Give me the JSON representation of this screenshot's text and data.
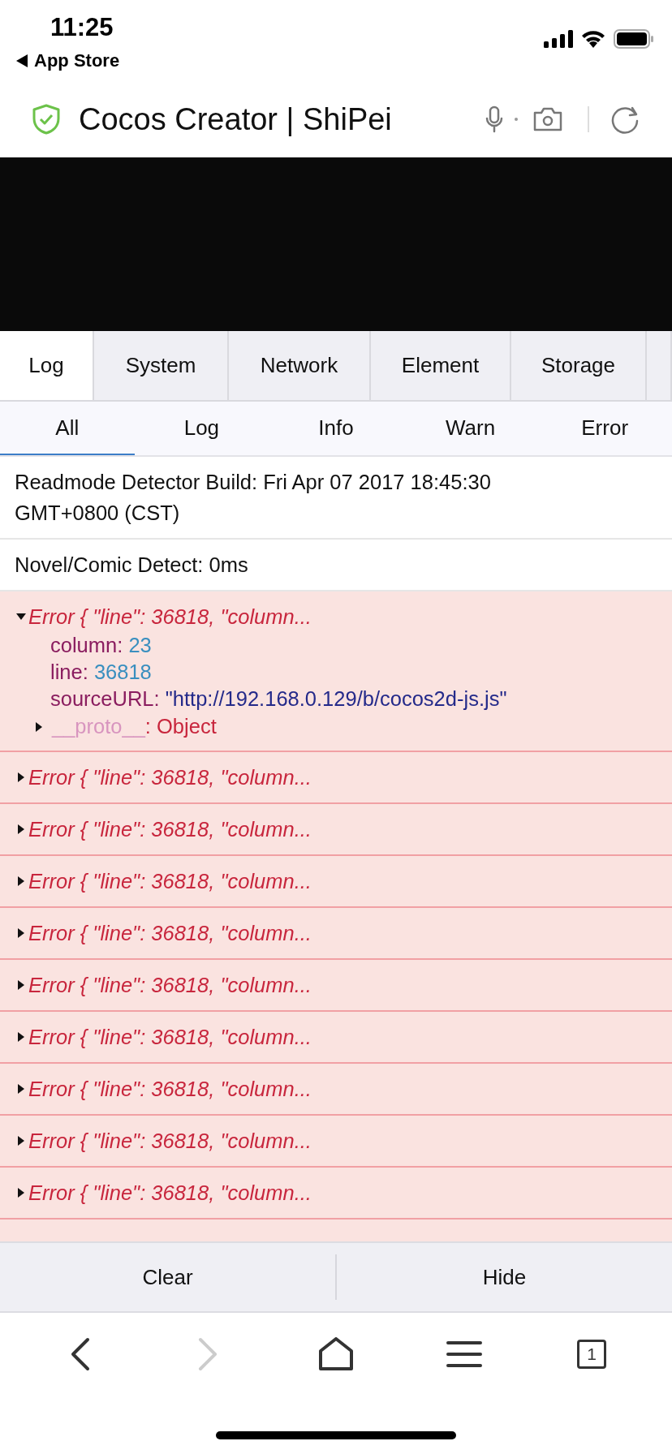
{
  "status_bar": {
    "time": "11:25",
    "back_label": "App Store"
  },
  "browser": {
    "title": "Cocos Creator | ShiPei"
  },
  "tabs": [
    {
      "label": "Log",
      "selected": true
    },
    {
      "label": "System",
      "selected": false
    },
    {
      "label": "Network",
      "selected": false
    },
    {
      "label": "Element",
      "selected": false
    },
    {
      "label": "Storage",
      "selected": false
    }
  ],
  "filters": [
    {
      "label": "All",
      "selected": true
    },
    {
      "label": "Log",
      "selected": false
    },
    {
      "label": "Info",
      "selected": false
    },
    {
      "label": "Warn",
      "selected": false
    },
    {
      "label": "Error",
      "selected": false
    }
  ],
  "logs": [
    {
      "kind": "info",
      "text": "Readmode Detector Build: Fri Apr 07 2017 18:45:30 GMT+0800 (CST)"
    },
    {
      "kind": "info",
      "text": "Novel/Comic Detect: 0ms"
    },
    {
      "kind": "error",
      "expanded": true,
      "text": "Error { \"line\": 36818, \"column...",
      "properties": [
        {
          "key": "column:",
          "value": "23",
          "kind": "number"
        },
        {
          "key": "line:",
          "value": "36818",
          "kind": "number"
        },
        {
          "key": "sourceURL:",
          "value": "\"http://192.168.0.129/b/cocos2d-js.js\"",
          "kind": "string"
        }
      ],
      "proto": {
        "key": "__proto__",
        "value": ": Object",
        "expanded": false
      }
    },
    {
      "kind": "error",
      "expanded": false,
      "text": "Error { \"line\": 36818, \"column..."
    },
    {
      "kind": "error",
      "expanded": false,
      "text": "Error { \"line\": 36818, \"column..."
    },
    {
      "kind": "error",
      "expanded": false,
      "text": "Error { \"line\": 36818, \"column..."
    },
    {
      "kind": "error",
      "expanded": false,
      "text": "Error { \"line\": 36818, \"column..."
    },
    {
      "kind": "error",
      "expanded": false,
      "text": "Error { \"line\": 36818, \"column..."
    },
    {
      "kind": "error",
      "expanded": false,
      "text": "Error { \"line\": 36818, \"column..."
    },
    {
      "kind": "error",
      "expanded": false,
      "text": "Error { \"line\": 36818, \"column..."
    },
    {
      "kind": "error",
      "expanded": false,
      "text": "Error { \"line\": 36818, \"column..."
    },
    {
      "kind": "error",
      "expanded": false,
      "text": "Error { \"line\": 36818, \"column..."
    }
  ],
  "actions": [
    "Clear",
    "Hide"
  ],
  "nav": {
    "back_disabled": false,
    "forward_disabled": true,
    "tab_count": "1"
  }
}
